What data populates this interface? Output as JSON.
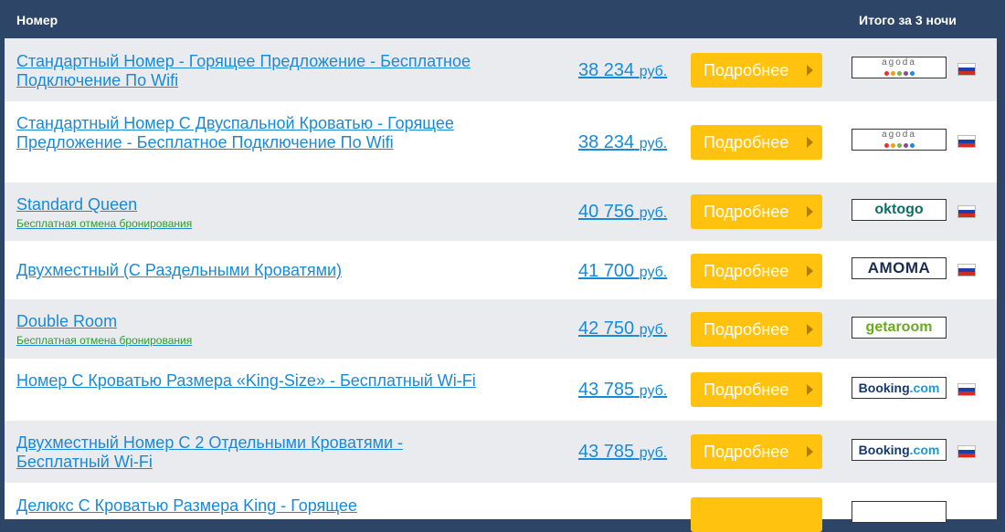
{
  "header": {
    "col_room": "Номер",
    "col_total": "Итого за 3 ночи"
  },
  "button_label": "Подробнее",
  "rows": [
    {
      "room": "Стандартный Номер - Горящее Предложение - Бесплатное Подключение По Wifi",
      "note": "",
      "price": "38 234",
      "currency": "руб.",
      "provider": "agoda",
      "flag": "ru"
    },
    {
      "room": "Стандартный Номер С Двуспальной Кроватью - Горящее Предложение - Бесплатное Подключение По Wifi",
      "note": "",
      "price": "38 234",
      "currency": "руб.",
      "provider": "agoda",
      "flag": "ru"
    },
    {
      "room": "Standard Queen",
      "note": "Бесплатная отмена бронирования",
      "price": "40 756",
      "currency": "руб.",
      "provider": "oktogo",
      "flag": "ru"
    },
    {
      "room": "Двухместный (С Раздельными Кроватями)",
      "note": "",
      "price": "41 700",
      "currency": "руб.",
      "provider": "AMOMA",
      "flag": "ru"
    },
    {
      "room": "Double Room",
      "note": "Бесплатная отмена бронирования",
      "price": "42 750",
      "currency": "руб.",
      "provider": "getaroom",
      "flag": ""
    },
    {
      "room": "Номер С Кроватью Размера «King-Size» - Бесплатный Wi-Fi",
      "note": "",
      "price": "43 785",
      "currency": "руб.",
      "provider": "Booking.com",
      "flag": "ru"
    },
    {
      "room": "Двухместный Номер С 2 Отдельными Кроватями - Бесплатный Wi-Fi",
      "note": "",
      "price": "43 785",
      "currency": "руб.",
      "provider": "Booking.com",
      "flag": "ru"
    },
    {
      "room": "Делюкс С Кроватью Размера King - Горящее",
      "note": "",
      "price": "",
      "currency": "",
      "provider": "",
      "flag": ""
    }
  ],
  "logos": {
    "agoda": "agoda",
    "oktogo": "oktogo",
    "amoma": "AMOMA",
    "getaroom": "getaroom",
    "booking_main": "Booking",
    "booking_dot": ".com"
  },
  "colors": {
    "header_bg": "#2d4566",
    "link": "#1b8ad6",
    "button": "#ffc20e",
    "note": "#2f9b2f"
  }
}
